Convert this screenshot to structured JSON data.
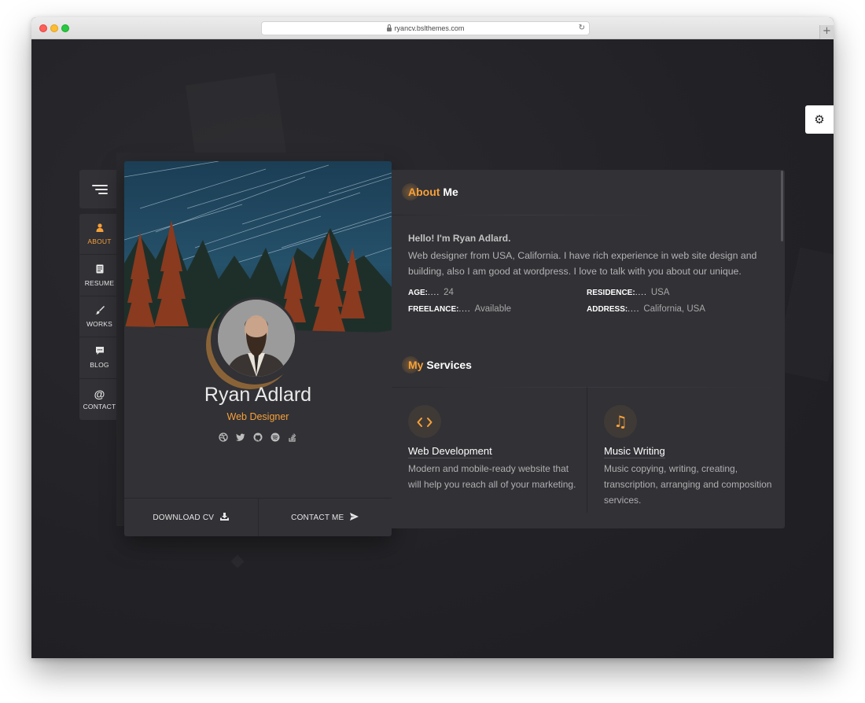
{
  "browser": {
    "url": "ryancv.bslthemes.com",
    "newtab_symbol": "+"
  },
  "settings_icon": "gear-icon",
  "nav": {
    "toggle_icon": "hamburger-icon",
    "items": [
      {
        "label": "ABOUT",
        "icon": "person-icon",
        "glyph": "👤",
        "active": true
      },
      {
        "label": "RESUME",
        "icon": "document-icon",
        "glyph": "▤",
        "active": false
      },
      {
        "label": "WORKS",
        "icon": "brush-icon",
        "glyph": "✎",
        "active": false
      },
      {
        "label": "BLOG",
        "icon": "comment-icon",
        "glyph": "▣",
        "active": false
      },
      {
        "label": "CONTACT",
        "icon": "at-icon",
        "glyph": "@",
        "active": false
      }
    ]
  },
  "profile": {
    "name": "Ryan Adlard",
    "role": "Web Designer",
    "socials": [
      {
        "icon": "dribbble-icon",
        "glyph": "◍"
      },
      {
        "icon": "twitter-icon",
        "glyph": "✦"
      },
      {
        "icon": "github-icon",
        "glyph": "●"
      },
      {
        "icon": "spotify-icon",
        "glyph": "≋"
      },
      {
        "icon": "stack-overflow-icon",
        "glyph": "≡"
      }
    ],
    "download_label": "DOWNLOAD CV",
    "contact_label": "CONTACT ME"
  },
  "about": {
    "title_accent": "About",
    "title_rest": " Me",
    "greeting": "Hello! I'm Ryan Adlard.",
    "text": "Web designer from USA, California. I have rich experience in web site design and building, also I am good at wordpress. I love to talk with you about our unique.",
    "info": [
      {
        "key": "AGE:",
        "value": "24"
      },
      {
        "key": "RESIDENCE:",
        "value": "USA"
      },
      {
        "key": "FREELANCE:",
        "value": "Available"
      },
      {
        "key": "ADDRESS:",
        "value": "California, USA"
      }
    ],
    "dots": "...."
  },
  "services": {
    "title_accent": "My",
    "title_rest": " Services",
    "items": [
      {
        "icon": "code-icon",
        "glyph": "< >",
        "title": "Web Development",
        "desc": "Modern and mobile-ready website that will help you reach all of your marketing."
      },
      {
        "icon": "music-icon",
        "glyph": "♫",
        "title": "Music Writing",
        "desc": "Music copying, writing, creating, transcription, arranging and composition services."
      }
    ]
  },
  "colors": {
    "accent": "#f7a139",
    "panel": "#313136",
    "background": "#232327"
  }
}
